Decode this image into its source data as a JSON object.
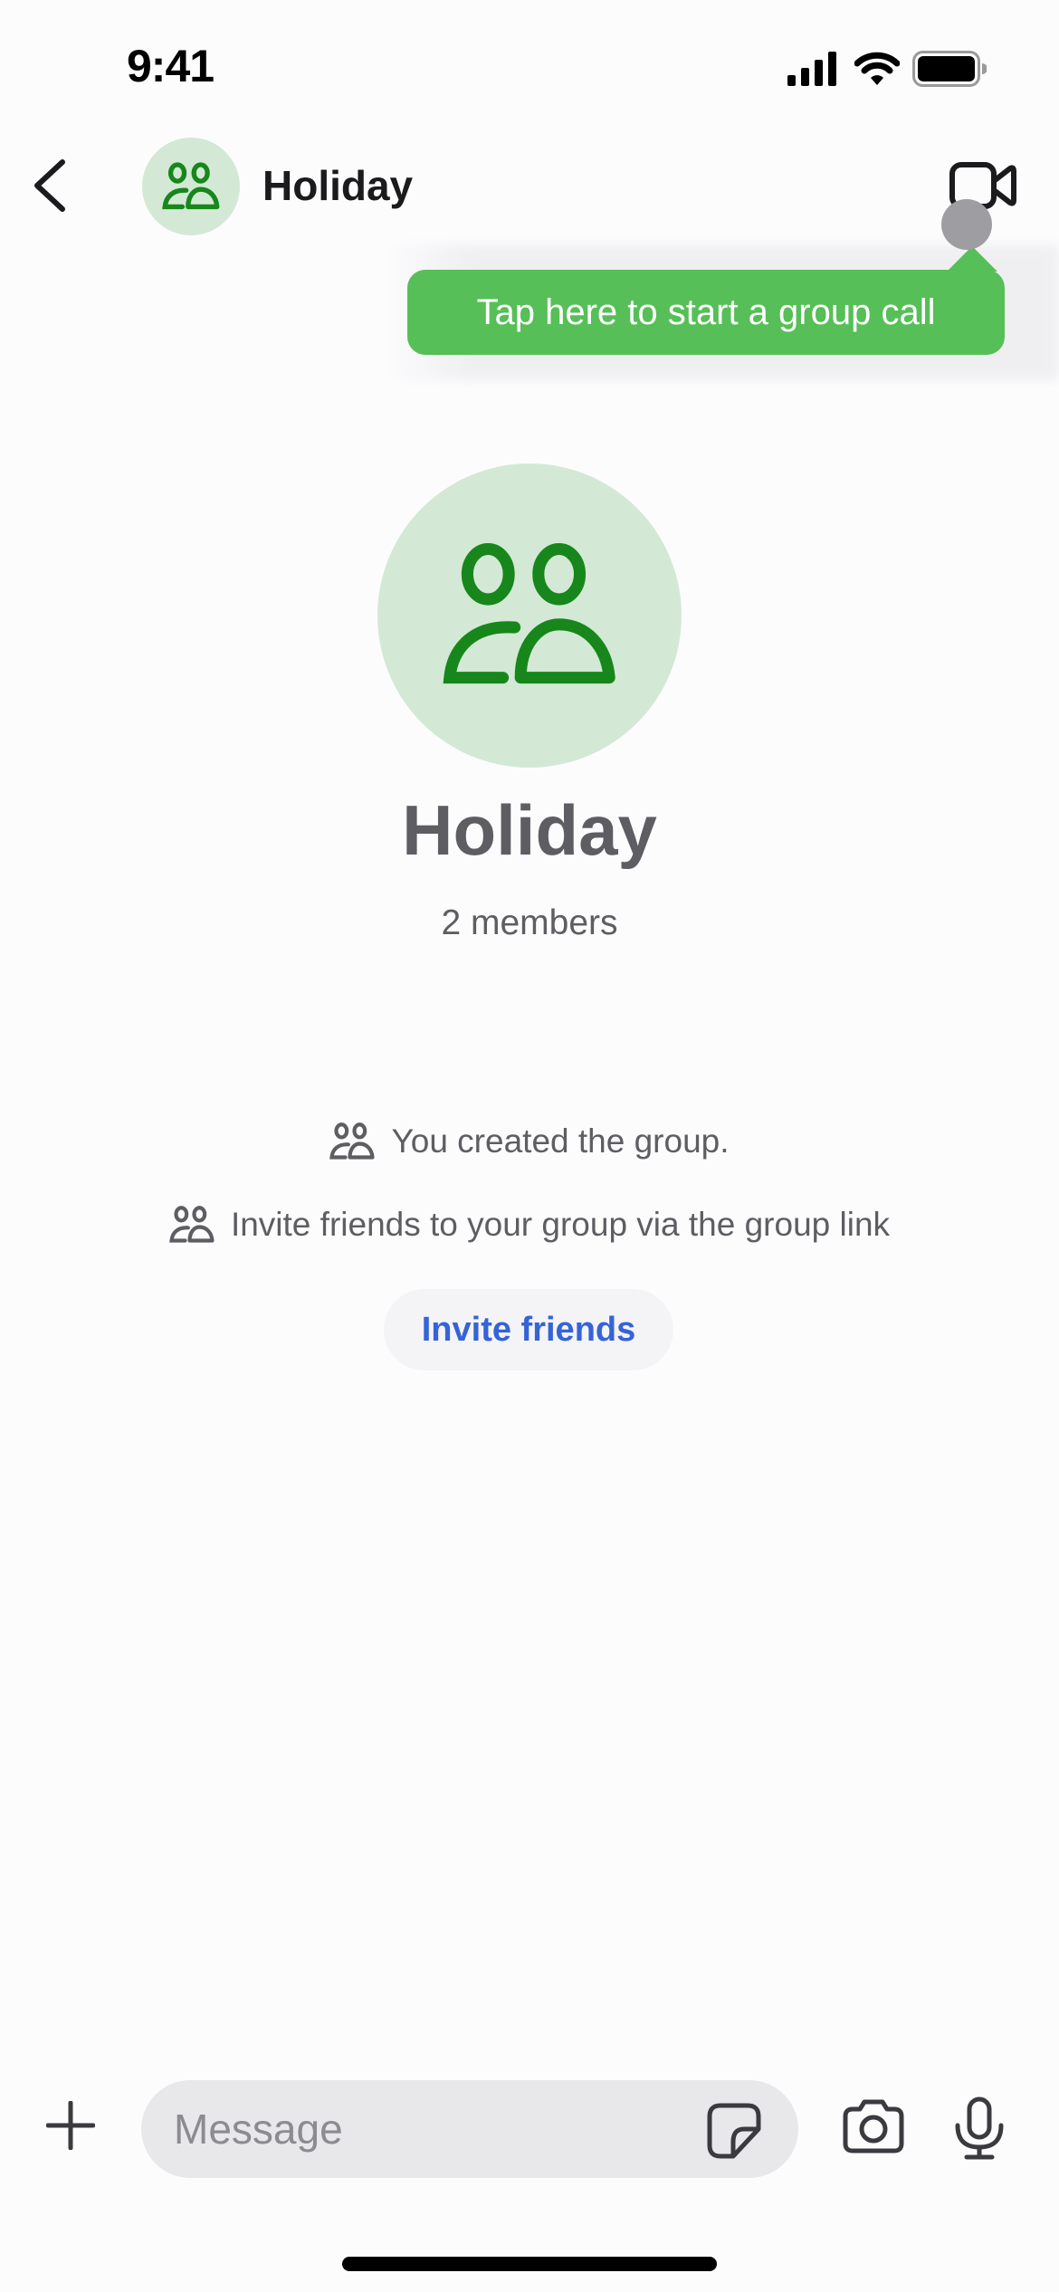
{
  "status_bar": {
    "time": "9:41",
    "icons": [
      "cellular-signal-icon",
      "wifi-icon",
      "battery-icon"
    ]
  },
  "header": {
    "back_icon": "chevron-left-icon",
    "avatar_icon": "group-icon",
    "title": "Holiday",
    "video_call_icon": "video-camera-icon"
  },
  "tooltip": {
    "text": "Tap here to start a group call"
  },
  "hero": {
    "avatar_icon": "group-icon",
    "title": "Holiday",
    "subtitle": "2 members"
  },
  "events": [
    {
      "icon": "group-icon",
      "text": "You created the group."
    },
    {
      "icon": "group-icon",
      "text": "Invite friends to your group via the group link"
    }
  ],
  "invite_button": {
    "label": "Invite friends"
  },
  "composer": {
    "attach_icon": "plus-icon",
    "message_placeholder": "Message",
    "message_value": "",
    "sticker_icon": "sticker-icon",
    "camera_icon": "camera-icon",
    "mic_icon": "microphone-icon"
  },
  "colors": {
    "accent_green": "#56bf57",
    "avatar_bg": "#d3e9d5",
    "avatar_fg": "#17871c",
    "link_blue": "#3563d8",
    "secondary_text": "#5e5d62"
  }
}
